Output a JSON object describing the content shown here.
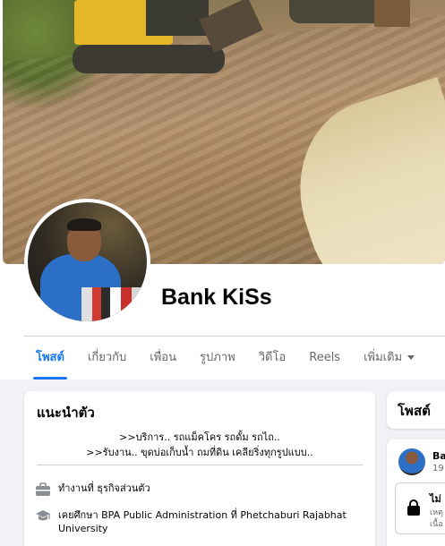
{
  "profile": {
    "name": "Bank KiSs"
  },
  "tabs": [
    {
      "label": "โพสต์",
      "active": true
    },
    {
      "label": "เกี่ยวกับ",
      "active": false
    },
    {
      "label": "เพื่อน",
      "active": false
    },
    {
      "label": "รูปภาพ",
      "active": false
    },
    {
      "label": "วิดีโอ",
      "active": false
    },
    {
      "label": "Reels",
      "active": false
    },
    {
      "label": "เพิ่มเติม",
      "active": false
    }
  ],
  "intro": {
    "title": "แนะนำตัว",
    "bio_line1": ">>บริการ.. รถแม็คโคร รถดั้ม รถไถ..",
    "bio_line2": ">>รับงาน.. ขุดบ่อเก็บน้ำ ถมที่ดิน เคลียริ่งทุกรูปแบบ..",
    "work": "ทำงานที่ ธุรกิจส่วนตัว",
    "education": "เคยศึกษา BPA Public Administration ที่ Phetchaburi Rajabhat University"
  },
  "posts_panel": {
    "title": "โพสต์",
    "author_partial": "Ba",
    "date_partial": "19",
    "notice_title_partial": "ไม่",
    "notice_line1_partial": "เหตุ",
    "notice_line2_partial": "เนื้อ"
  },
  "colors": {
    "accent": "#1877f2",
    "background": "#f0f2f5",
    "secondary_text": "#65676b"
  }
}
